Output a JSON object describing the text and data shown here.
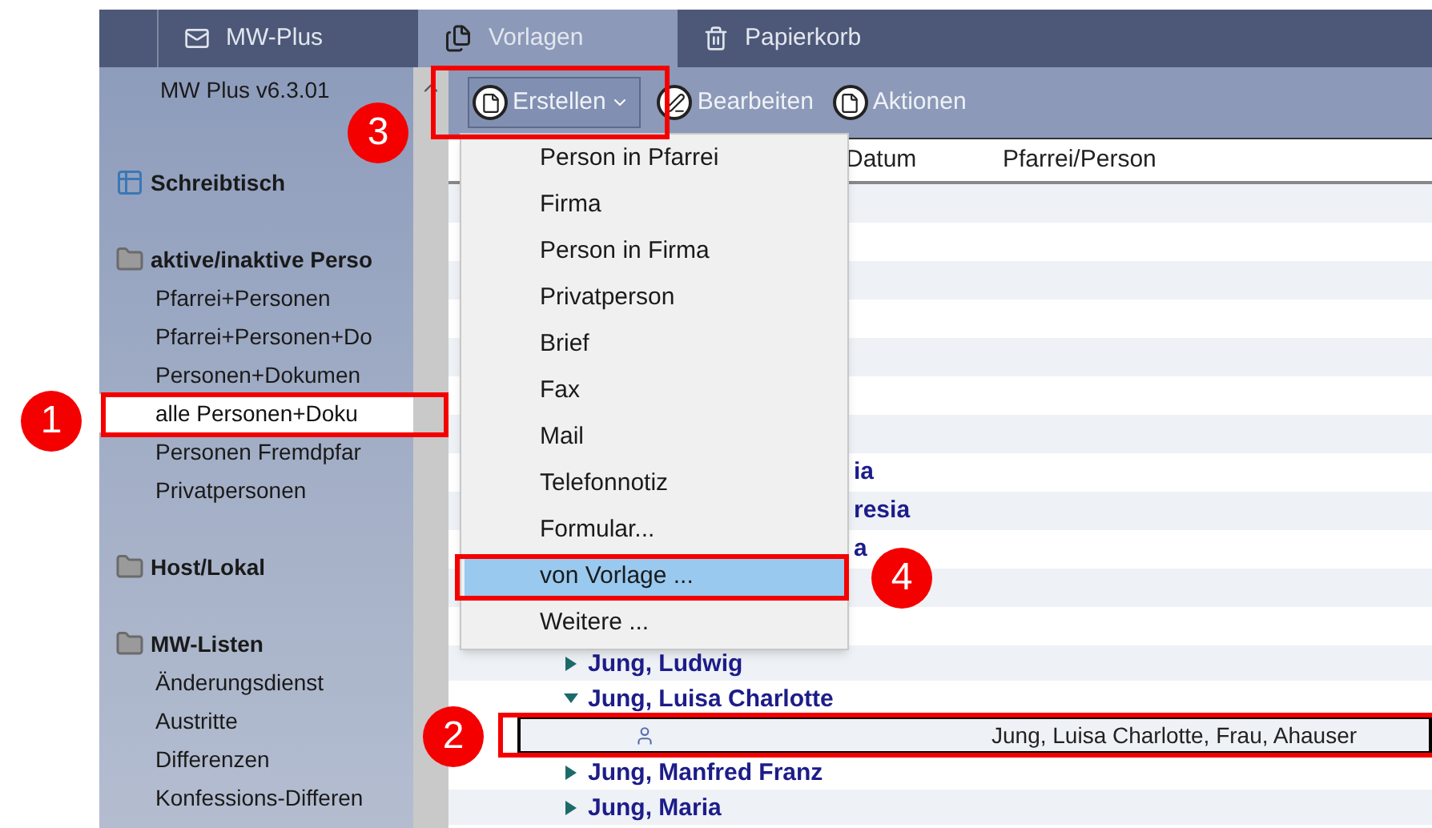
{
  "tabs": [
    {
      "label": "MW-Plus",
      "selected": false,
      "kind": "mail"
    },
    {
      "label": "Vorlagen",
      "selected": true,
      "kind": "templates"
    },
    {
      "label": "Papierkorb",
      "selected": false,
      "kind": "trash"
    }
  ],
  "sidebar": {
    "version": "MW Plus v6.3.01",
    "sections": [
      {
        "title": "Schreibtisch",
        "kind": "desk"
      },
      {
        "title": "aktive/inaktive Perso",
        "kind": "folder",
        "items": [
          {
            "label": "Pfarrei+Personen",
            "selected": false
          },
          {
            "label": "Pfarrei+Personen+Do",
            "selected": false
          },
          {
            "label": "Personen+Dokumen",
            "selected": false
          },
          {
            "label": "alle Personen+Doku",
            "selected": true
          },
          {
            "label": "Personen Fremdpfar",
            "selected": false
          },
          {
            "label": "Privatpersonen",
            "selected": false
          }
        ]
      },
      {
        "title": "Host/Lokal",
        "kind": "folder"
      },
      {
        "title": "MW-Listen",
        "kind": "folder",
        "items": [
          {
            "label": "Änderungsdienst",
            "selected": false
          },
          {
            "label": "Austritte",
            "selected": false
          },
          {
            "label": "Differenzen",
            "selected": false
          },
          {
            "label": "Konfessions-Differen",
            "selected": false
          }
        ]
      }
    ]
  },
  "toolbar": [
    {
      "label": "Erstellen",
      "kind": "dropdown"
    },
    {
      "label": "Bearbeiten",
      "kind": "edit"
    },
    {
      "label": "Aktionen",
      "kind": "action"
    }
  ],
  "menu": {
    "items": [
      {
        "label": "Person in Pfarrei",
        "selected": false
      },
      {
        "label": "Firma",
        "selected": false
      },
      {
        "label": "Person in Firma",
        "selected": false
      },
      {
        "label": "Privatperson",
        "selected": false
      },
      {
        "label": "Brief",
        "selected": false
      },
      {
        "label": "Fax",
        "selected": false
      },
      {
        "label": "Mail",
        "selected": false
      },
      {
        "label": "Telefonnotiz",
        "selected": false
      },
      {
        "label": "Formular...",
        "selected": false
      },
      {
        "label": "von Vorlage ...",
        "selected": true
      },
      {
        "label": "Weitere ...",
        "selected": false
      }
    ]
  },
  "table": {
    "columns": [
      "Datum",
      "Pfarrei/Person"
    ],
    "rows": [
      {
        "kind": "fragment",
        "text": "ia"
      },
      {
        "kind": "fragment",
        "text": "resia"
      },
      {
        "kind": "fragment",
        "text": "a"
      },
      {
        "kind": "node",
        "name": "Jung, Ludwig",
        "expanded": false
      },
      {
        "kind": "node",
        "name": "Jung, Luisa Charlotte",
        "expanded": true
      },
      {
        "kind": "leaf",
        "pfarrei_person": "Jung, Luisa Charlotte, Frau, Ahauser",
        "selected": true
      },
      {
        "kind": "node",
        "name": "Jung, Manfred Franz",
        "expanded": false
      },
      {
        "kind": "node",
        "name": "Jung, Maria",
        "expanded": false
      }
    ]
  },
  "callouts": [
    {
      "number": "1"
    },
    {
      "number": "2"
    },
    {
      "number": "3"
    },
    {
      "number": "4"
    }
  ]
}
